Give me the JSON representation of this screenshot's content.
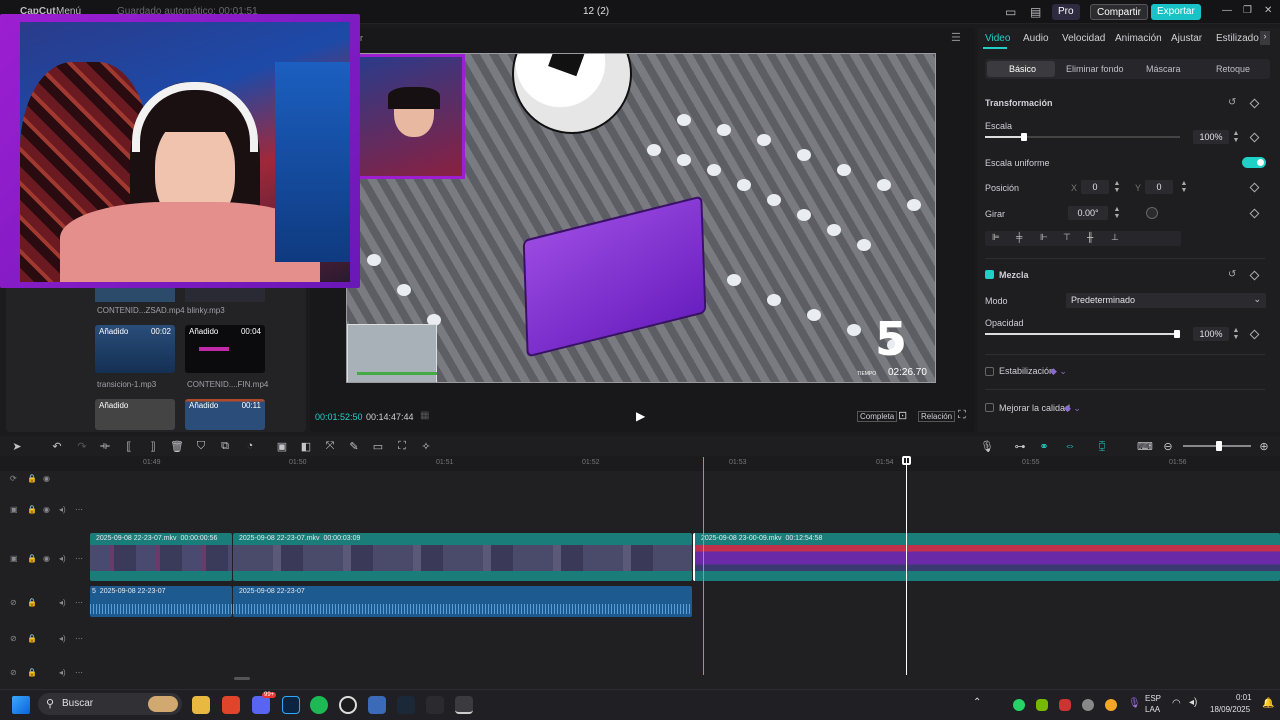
{
  "titlebar": {
    "app": "CapCut",
    "menu": "Menú",
    "autosave": "Guardado automático: 00:01:51",
    "project": "12 (2)",
    "pro": "Pro",
    "share": "Compartir",
    "export": "Exportar"
  },
  "media": {
    "items": [
      {
        "name": "CONTENID...ZSAD.mp4",
        "tag": "",
        "dur": ""
      },
      {
        "name": "blinky.mp3",
        "tag": "",
        "dur": ""
      },
      {
        "name": "transicion-1.mp3",
        "tag": "Añadido",
        "dur": "00:02"
      },
      {
        "name": "CONTENID....FIN.mp4",
        "tag": "Añadido",
        "dur": "00:04"
      },
      {
        "name": "",
        "tag": "Añadido",
        "dur": ""
      },
      {
        "name": "",
        "tag": "Añadido",
        "dur": "00:11"
      }
    ]
  },
  "player": {
    "current": "00:01:52:50",
    "total": "00:14:47:44",
    "full": "Completa",
    "ratio": "Relación",
    "overlay_number": "5",
    "overlay_label": "TIEMPO",
    "overlay_time": "02:26.70",
    "side_label": "or"
  },
  "right": {
    "tabs": [
      "Video",
      "Audio",
      "Velocidad",
      "Animación",
      "Ajustar",
      "Estilizado"
    ],
    "subtabs": [
      "Básico",
      "Eliminar fondo",
      "Máscara",
      "Retoque"
    ],
    "transform": "Transformación",
    "scale_label": "Escala",
    "scale_value": "100%",
    "scale_level": 0.2,
    "uniform": "Escala uniforme",
    "position": "Posición",
    "pos_x_label": "X",
    "pos_x": "0",
    "pos_y_label": "Y",
    "pos_y": "0",
    "rotate": "Girar",
    "rotate_value": "0.00°",
    "blend": "Mezcla",
    "mode_label": "Modo",
    "mode_value": "Predeterminado",
    "opacity_label": "Opacidad",
    "opacity_value": "100%",
    "opacity_level": 1.0,
    "stabilize": "Estabilización",
    "enhance": "Mejorar la calidad"
  },
  "timeline": {
    "ticks": [
      "01:49",
      "01:50",
      "01:51",
      "01:52",
      "01:53",
      "01:54",
      "01:55",
      "01:56"
    ],
    "clips": [
      {
        "label": "2025-09-08 22-23-07.mkv",
        "dur": "00:00:00:56"
      },
      {
        "label": "2025-09-08 22-23-07.mkv",
        "dur": "00:00:03:09"
      },
      {
        "label": "2025-09-08 23-00-09.mkv",
        "dur": "00:12:54:58"
      }
    ],
    "audio": [
      {
        "label": "2025-09-08 22-23-07"
      },
      {
        "label": "2025-09-08 22-23-07"
      }
    ],
    "audio_prefix": "5"
  },
  "taskbar": {
    "search": "Buscar",
    "lang1": "ESP",
    "lang2": "LAA",
    "time": "0:01",
    "date": "18/09/2025",
    "badge": "99+"
  },
  "colors": {
    "accent": "#1fd0c6",
    "export_btn": "#19c2c7",
    "cam_border": "#9c1fd1",
    "playhead": "#ffffff",
    "clip_video": "#1a7d7a",
    "clip_audio": "#1d5a8f",
    "purple_box": "#7b2bd1"
  }
}
